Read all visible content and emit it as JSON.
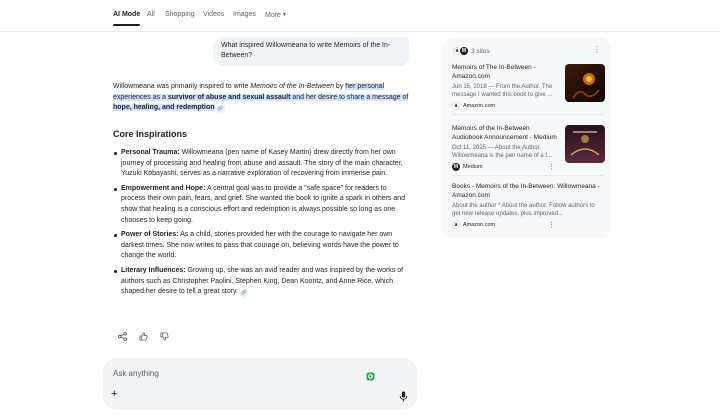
{
  "nav": {
    "tabs": [
      "AI Mode",
      "All",
      "Shopping",
      "Videos",
      "Images",
      "More"
    ]
  },
  "query": "What inspired Willowmeana to write Memoirs of the In-Between?",
  "answer": {
    "p1_a": "Willowmeana was primarily inspired to write ",
    "p1_title": "Memoirs of the In-Between",
    "p1_b": " by ",
    "p1_hl1": "her personal experiences as a ",
    "p1_hl_bold1": "survivor of abuse and sexual assault",
    "p1_hl2": " and her desire to share a message of ",
    "p1_hl_bold2": "hope, healing, and redemption",
    "section_title": "Core Inspirations",
    "bullets": [
      {
        "head": "Personal Trauma:",
        "text": " Willowmeana (pen name of Kasey Martin) drew directly from her own journey of processing and healing from abuse and assault. The story of the main character, Yuzuki Kobayashi, serves as a narrative exploration of recovering from immense pain."
      },
      {
        "head": "Empowerment and Hope:",
        "text": " A central goal was to provide a \"safe space\" for readers to process their own pain, fears, and grief. She wanted the book to ignite a spark in others and show that healing is a conscious effort and redemption is always possible so long as one chooses to keep going."
      },
      {
        "head": "Power of Stories:",
        "text": " As a child, stories provided her with the courage to navigate her own darkest times. She now writes to pass that courage on, believing words have the power to change the world."
      },
      {
        "head": "Literary Influences:",
        "text": " Growing up, she was an avid reader and was inspired by the works of authors such as Christopher Paolini, Stephen King, Dean Koontz, and Anne Rice, which shaped her desire to tell a great story."
      }
    ]
  },
  "ask": {
    "placeholder": "Ask anything",
    "plus_label": "+"
  },
  "sources": {
    "count_label": "3 sites",
    "more_label": "⋮",
    "items": [
      {
        "title": "Memoirs of The In-Between - Amazon.com",
        "snippet": "Jun 15, 2018 — From the Author. The message I wanted this book to give ...",
        "site": "Amazon.com",
        "fav": "a"
      },
      {
        "title": "Memoirs of the In-Between Audiobook Announcement - Medium",
        "snippet": "Oct 11, 2025 — About the Author. Willowmeana is the pen name of a f...",
        "site": "Medium",
        "fav": "M"
      },
      {
        "title": "Books - Memoirs of the In-Between: Willowmeana - Amazon.com",
        "snippet": "About the author * About the author. Follow authors to get new release updates, plus improved...",
        "site": "Amazon.com",
        "fav": "a"
      }
    ]
  },
  "colors": {
    "highlight": "#d3e3fd",
    "panel_bg": "#f7f8fa",
    "ask_bg": "#f1f3f4"
  }
}
